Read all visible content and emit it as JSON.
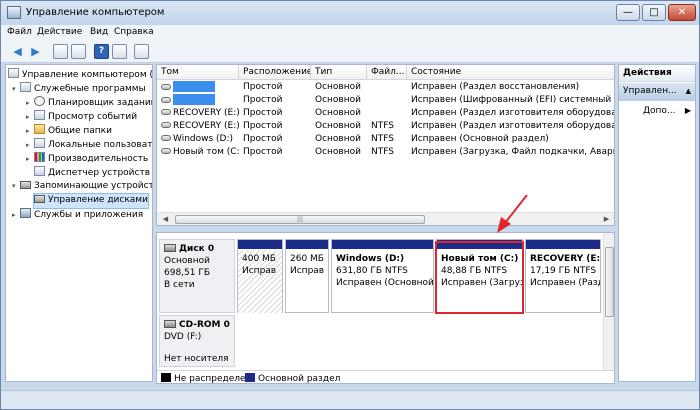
{
  "window": {
    "title": "Управление компьютером",
    "min_glyph": "—",
    "max_glyph": "□",
    "close_glyph": "✕"
  },
  "menu": [
    "Файл",
    "Действие",
    "Вид",
    "Справка"
  ],
  "toolbar": {
    "back_glyph": "◀",
    "forward_glyph": "▶",
    "help_glyph": "?"
  },
  "tree": [
    {
      "label": "Управление компьютером (л",
      "exp": "",
      "icon": "computer-icon"
    },
    {
      "label": "Служебные программы",
      "exp": "▾",
      "icon": "tools-icon"
    },
    {
      "label": "Планировщик заданий",
      "exp": "▸",
      "icon": "clock-icon"
    },
    {
      "label": "Просмотр событий",
      "exp": "▸",
      "icon": "event-viewer-icon"
    },
    {
      "label": "Общие папки",
      "exp": "▸",
      "icon": "shared-folder-icon"
    },
    {
      "label": "Локальные пользовате",
      "exp": "▸",
      "icon": "users-icon"
    },
    {
      "label": "Производительность",
      "exp": "▸",
      "icon": "performance-icon"
    },
    {
      "label": "Диспетчер устройств",
      "exp": "",
      "icon": "device-manager-icon"
    },
    {
      "label": "Запоминающие устройст",
      "exp": "▾",
      "icon": "storage-icon"
    },
    {
      "label": "Управление дисками",
      "exp": "",
      "icon": "disk-management-icon"
    },
    {
      "label": "Службы и приложения",
      "exp": "▸",
      "icon": "services-icon"
    }
  ],
  "volumes": {
    "columns": [
      "Том",
      "Расположение",
      "Тип",
      "Файл...",
      "Состояние"
    ],
    "rows": [
      {
        "name": "",
        "highlighted": true,
        "layout": "Простой",
        "type": "Основной",
        "fs": "",
        "status": "Исправен (Раздел восстановления)"
      },
      {
        "name": "",
        "highlighted": true,
        "layout": "Простой",
        "type": "Основной",
        "fs": "",
        "status": "Исправен (Шифрованный (EFI) системный раздел"
      },
      {
        "name": "RECOVERY (E:)",
        "highlighted": false,
        "layout": "Простой",
        "type": "Основной",
        "fs": "",
        "status": "Исправен (Раздел изготовителя оборудования (O"
      },
      {
        "name": "RECOVERY (E:)",
        "highlighted": false,
        "layout": "Простой",
        "type": "Основной",
        "fs": "NTFS",
        "status": "Исправен (Раздел изготовителя оборудования (O"
      },
      {
        "name": "Windows (D:)",
        "highlighted": false,
        "layout": "Простой",
        "type": "Основной",
        "fs": "NTFS",
        "status": "Исправен (Основной раздел)"
      },
      {
        "name": "Новый том (C:)",
        "highlighted": false,
        "layout": "Простой",
        "type": "Основной",
        "fs": "NTFS",
        "status": "Исправен (Загрузка, Файл подкачки, Аварийный"
      }
    ]
  },
  "disk0": {
    "name": "Диск 0",
    "type": "Основной",
    "size": "698,51 ГБ",
    "state": "В сети",
    "partitions": [
      {
        "title": "",
        "size": "400 МБ",
        "status": "Исправ"
      },
      {
        "title": "",
        "size": "260 МБ",
        "status": "Исправ"
      },
      {
        "title": "Windows  (D:)",
        "size": "631,80 ГБ NTFS",
        "status": "Исправен (Основной р"
      },
      {
        "title": "Новый том  (C:)",
        "size": "48,88 ГБ NTFS",
        "status": "Исправен (Загруз"
      },
      {
        "title": "RECOVERY  (E:)",
        "size": "17,19 ГБ NTFS",
        "status": "Исправен (Разд"
      }
    ]
  },
  "cdrom0": {
    "name": "CD-ROM 0",
    "drive": "DVD (F:)",
    "media": "Нет носителя"
  },
  "legend": [
    {
      "label": "Не распределен",
      "color": "#000000"
    },
    {
      "label": "Основной раздел",
      "color": "#1d2c8b"
    }
  ],
  "actions": {
    "title": "Действия",
    "section": "Управлен...",
    "more": "Допо..."
  },
  "colors": {
    "highlight": "#3c8ded",
    "annotation_red": "#e3262e"
  }
}
